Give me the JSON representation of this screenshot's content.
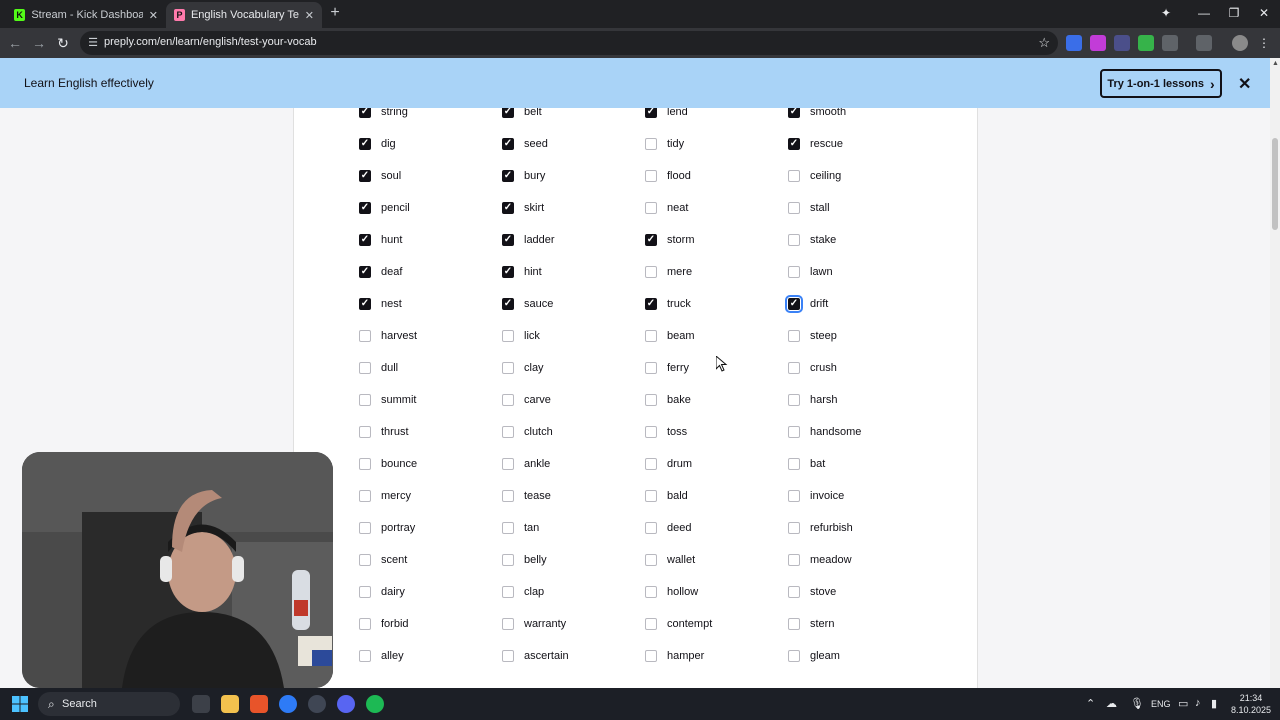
{
  "browser": {
    "tabs": [
      {
        "title": "Stream - Kick Dashboard",
        "favicon_color": "#53fc18",
        "favicon_letter": "K",
        "active": false
      },
      {
        "title": "English Vocabulary Test: How M",
        "favicon_color": "#ff7aac",
        "favicon_letter": "P",
        "active": true
      }
    ],
    "url": "preply.com/en/learn/english/test-your-vocab"
  },
  "banner": {
    "text": "Learn English effectively",
    "cta_label": "Try 1-on-1 lessons"
  },
  "vocab": {
    "columns": [
      [
        {
          "word": "string",
          "checked": true
        },
        {
          "word": "dig",
          "checked": true
        },
        {
          "word": "soul",
          "checked": true
        },
        {
          "word": "pencil",
          "checked": true
        },
        {
          "word": "hunt",
          "checked": true
        },
        {
          "word": "deaf",
          "checked": true
        },
        {
          "word": "nest",
          "checked": true
        },
        {
          "word": "harvest",
          "checked": false
        },
        {
          "word": "dull",
          "checked": false
        },
        {
          "word": "summit",
          "checked": false
        },
        {
          "word": "thrust",
          "checked": false
        },
        {
          "word": "bounce",
          "checked": false
        },
        {
          "word": "mercy",
          "checked": false
        },
        {
          "word": "portray",
          "checked": false
        },
        {
          "word": "scent",
          "checked": false
        },
        {
          "word": "dairy",
          "checked": false
        },
        {
          "word": "forbid",
          "checked": false
        },
        {
          "word": "alley",
          "checked": false
        }
      ],
      [
        {
          "word": "belt",
          "checked": true
        },
        {
          "word": "seed",
          "checked": true
        },
        {
          "word": "bury",
          "checked": true
        },
        {
          "word": "skirt",
          "checked": true
        },
        {
          "word": "ladder",
          "checked": true
        },
        {
          "word": "hint",
          "checked": true
        },
        {
          "word": "sauce",
          "checked": true
        },
        {
          "word": "lick",
          "checked": false
        },
        {
          "word": "clay",
          "checked": false
        },
        {
          "word": "carve",
          "checked": false
        },
        {
          "word": "clutch",
          "checked": false
        },
        {
          "word": "ankle",
          "checked": false
        },
        {
          "word": "tease",
          "checked": false
        },
        {
          "word": "tan",
          "checked": false
        },
        {
          "word": "belly",
          "checked": false
        },
        {
          "word": "clap",
          "checked": false
        },
        {
          "word": "warranty",
          "checked": false
        },
        {
          "word": "ascertain",
          "checked": false
        }
      ],
      [
        {
          "word": "lend",
          "checked": true
        },
        {
          "word": "tidy",
          "checked": false
        },
        {
          "word": "flood",
          "checked": false
        },
        {
          "word": "neat",
          "checked": false
        },
        {
          "word": "storm",
          "checked": true
        },
        {
          "word": "mere",
          "checked": false
        },
        {
          "word": "truck",
          "checked": true
        },
        {
          "word": "beam",
          "checked": false
        },
        {
          "word": "ferry",
          "checked": false
        },
        {
          "word": "bake",
          "checked": false
        },
        {
          "word": "toss",
          "checked": false
        },
        {
          "word": "drum",
          "checked": false
        },
        {
          "word": "bald",
          "checked": false
        },
        {
          "word": "deed",
          "checked": false
        },
        {
          "word": "wallet",
          "checked": false
        },
        {
          "word": "hollow",
          "checked": false
        },
        {
          "word": "contempt",
          "checked": false
        },
        {
          "word": "hamper",
          "checked": false
        }
      ],
      [
        {
          "word": "smooth",
          "checked": true
        },
        {
          "word": "rescue",
          "checked": true
        },
        {
          "word": "ceiling",
          "checked": false
        },
        {
          "word": "stall",
          "checked": false
        },
        {
          "word": "stake",
          "checked": false
        },
        {
          "word": "lawn",
          "checked": false
        },
        {
          "word": "drift",
          "checked": true,
          "focused": true
        },
        {
          "word": "steep",
          "checked": false
        },
        {
          "word": "crush",
          "checked": false
        },
        {
          "word": "harsh",
          "checked": false
        },
        {
          "word": "handsome",
          "checked": false
        },
        {
          "word": "bat",
          "checked": false
        },
        {
          "word": "invoice",
          "checked": false
        },
        {
          "word": "refurbish",
          "checked": false
        },
        {
          "word": "meadow",
          "checked": false
        },
        {
          "word": "stove",
          "checked": false
        },
        {
          "word": "stern",
          "checked": false
        },
        {
          "word": "gleam",
          "checked": false
        }
      ]
    ]
  },
  "taskbar": {
    "search_label": "Search",
    "language": "ENG",
    "time": "21:34",
    "date": "8.10.2025"
  }
}
